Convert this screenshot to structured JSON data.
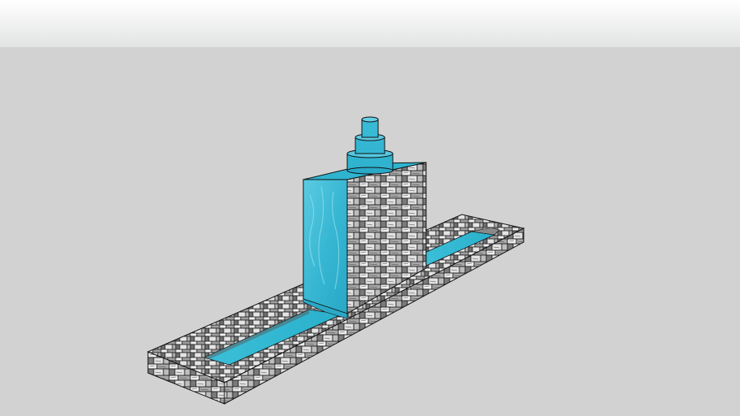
{
  "scene": {
    "subject": "fountain-model",
    "colors": {
      "sky_top": "#ffffff",
      "sky_bottom": "#e2e3e3",
      "ground": "#d2d2d2",
      "water": "#3fbcd6",
      "water_dark": "#1c9cb9",
      "water_light": "#7fd8ea",
      "stone_light": "#e6e6e6",
      "stone_mid": "#9a9a9a",
      "stone_dark": "#2b2b2b",
      "edge": "#111111"
    }
  }
}
